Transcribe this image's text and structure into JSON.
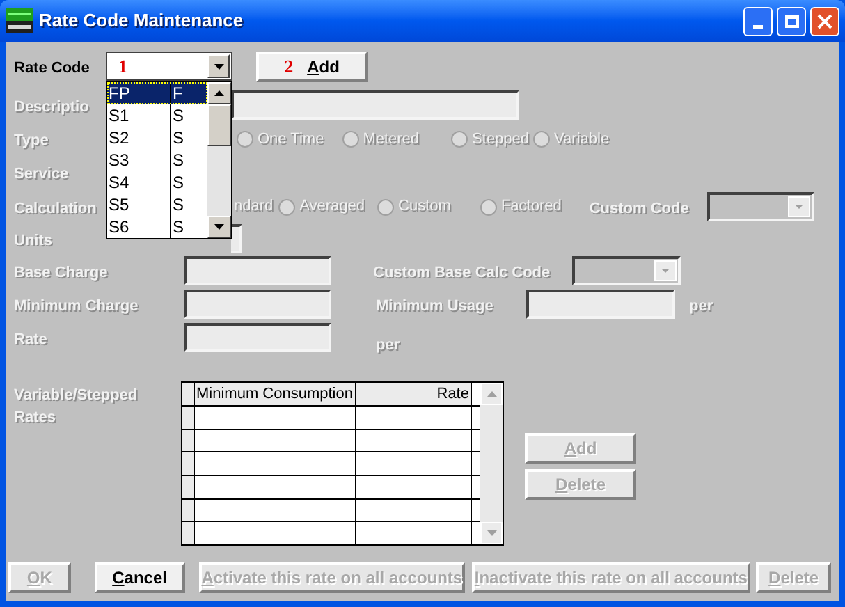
{
  "window": {
    "title": "Rate Code Maintenance"
  },
  "rate_code": {
    "label": "Rate Code",
    "marker": "1",
    "add_button": {
      "marker": "2",
      "label": "Add",
      "disabled": false
    }
  },
  "code_list": [
    {
      "code": "FP",
      "type": "F",
      "selected": true
    },
    {
      "code": "S1",
      "type": "S",
      "selected": false
    },
    {
      "code": "S2",
      "type": "S",
      "selected": false
    },
    {
      "code": "S3",
      "type": "S",
      "selected": false
    },
    {
      "code": "S4",
      "type": "S",
      "selected": false
    },
    {
      "code": "S5",
      "type": "S",
      "selected": false
    },
    {
      "code": "S6",
      "type": "S",
      "selected": false
    }
  ],
  "description": {
    "label": "Descriptio",
    "disabled": true
  },
  "type": {
    "label": "Type",
    "disabled": true,
    "options": [
      {
        "label": "One Time",
        "selected": false
      },
      {
        "label": "Metered",
        "selected": false
      },
      {
        "label": "Stepped",
        "selected": false
      },
      {
        "label": "Variable",
        "selected": false
      }
    ]
  },
  "service": {
    "label": "Service",
    "disabled": true
  },
  "calculation": {
    "label": "Calculation",
    "disabled": true,
    "options": [
      {
        "label": "ndard",
        "kind": "text"
      },
      {
        "label": "Averaged",
        "selected": false
      },
      {
        "label": "Custom",
        "selected": false
      },
      {
        "label": "Factored",
        "selected": false
      }
    ],
    "custom_code": {
      "label": "Custom Code"
    }
  },
  "units": {
    "label": "Units",
    "disabled": true
  },
  "base_charge": {
    "label": "Base Charge",
    "disabled": true,
    "custom_base_calc_code": {
      "label": "Custom Base Calc Code"
    }
  },
  "minimum_charge": {
    "label": "Minimum Charge",
    "disabled": true,
    "minimum_usage": {
      "label": "Minimum Usage",
      "unit": "per"
    }
  },
  "rate": {
    "label": "Rate",
    "disabled": true,
    "unit": "per"
  },
  "variable_stepped_rates": {
    "label": "Variable/Stepped Rates",
    "disabled": true,
    "columns": [
      "Minimum Consumption",
      "Rate"
    ],
    "buttons": [
      {
        "label": "Add",
        "disabled": true
      },
      {
        "label": "Delete",
        "disabled": true
      }
    ]
  },
  "buttons": [
    {
      "label": "OK",
      "disabled": true
    },
    {
      "label": "Cancel",
      "disabled": false
    },
    {
      "label": "Activate this rate on all accounts",
      "disabled": true
    },
    {
      "label": "Inactivate this rate on all accounts",
      "disabled": true
    },
    {
      "label": "Delete",
      "disabled": true
    }
  ]
}
